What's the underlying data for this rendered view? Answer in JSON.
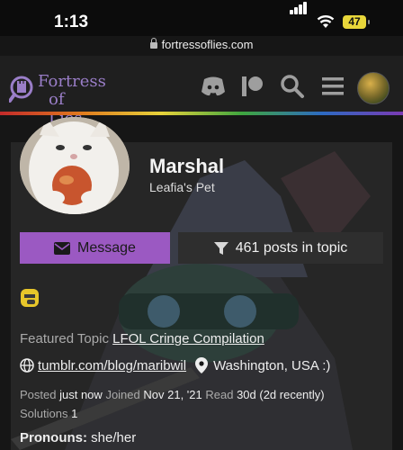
{
  "status_bar": {
    "time": "1:13",
    "battery": "47"
  },
  "browser": {
    "url": "fortressoflies.com"
  },
  "header": {
    "logo_line1": "Fortress",
    "logo_line2": "of Lies",
    "icons": [
      "discord-icon",
      "patreon-icon",
      "search-icon",
      "menu-icon",
      "user-avatar"
    ]
  },
  "profile": {
    "name": "Marshal",
    "title": "Leafia's Pet",
    "message_label": "Message",
    "posts_label": "461 posts in topic",
    "featured_label": "Featured Topic",
    "featured_topic": "LFOL Cringe Compilation",
    "website": "tumblr.com/blog/maribwil",
    "location": "Washington, USA :)",
    "posted_label": "Posted",
    "posted_value": "just now",
    "joined_label": "Joined",
    "joined_value": "Nov 21, '21",
    "read_label": "Read",
    "read_value": "30d (2d recently)",
    "solutions_label": "Solutions",
    "solutions_value": "1",
    "pronouns_label": "Pronouns:",
    "pronouns_value": "she/her"
  },
  "colors": {
    "accent": "#9b59c2",
    "background": "#161616",
    "card": "#262626",
    "logo": "#9a7ec8",
    "battery": "#e8d63a"
  }
}
